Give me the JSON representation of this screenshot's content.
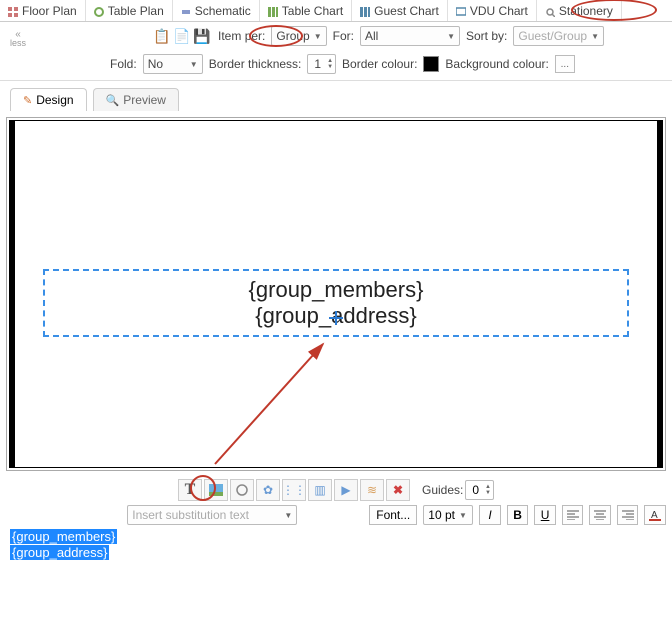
{
  "tabs": {
    "floorplan": "Floor Plan",
    "tableplan": "Table Plan",
    "schematic": "Schematic",
    "tablechart": "Table Chart",
    "guestchart": "Guest Chart",
    "vduchart": "VDU Chart",
    "stationery": "Stationery"
  },
  "less_label": "less",
  "toolbar1": {
    "item_per_label": "Item per:",
    "item_per_value": "Group",
    "for_label": "For:",
    "for_value": "All",
    "sort_by_label": "Sort by:",
    "sort_by_value": "Guest/Group"
  },
  "toolbar2": {
    "fold_label": "Fold:",
    "fold_value": "No",
    "border_thickness_label": "Border thickness:",
    "border_thickness_value": "1",
    "border_colour_label": "Border colour:",
    "background_colour_label": "Background colour:",
    "background_btn": "..."
  },
  "subtabs": {
    "design": "Design",
    "preview": "Preview"
  },
  "placeholder_line1": "{group_members}",
  "placeholder_line2": "{group_address}",
  "tools": {
    "guides_label": "Guides:",
    "guides_value": "0",
    "subst_placeholder": "Insert substitution text",
    "font_btn": "Font...",
    "font_size": "10 pt",
    "italic": "I",
    "bold": "B",
    "underline": "U"
  },
  "selected": {
    "line1": "{group_members}",
    "line2": "{group_address}"
  }
}
